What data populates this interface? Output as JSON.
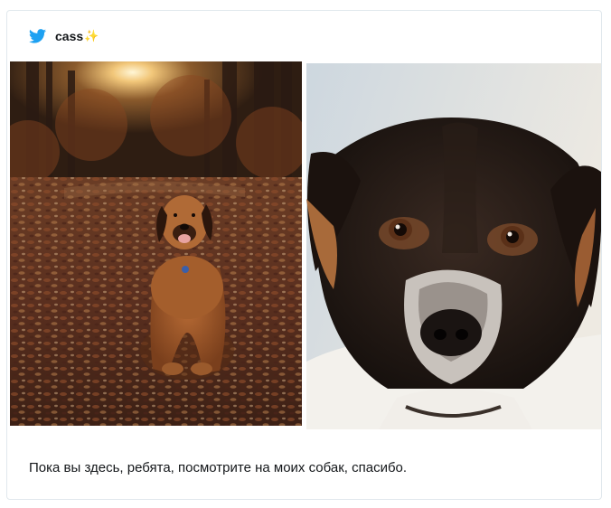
{
  "tweet": {
    "username": "cass",
    "username_emoji": "✨",
    "icon": "twitter-bird-icon",
    "text": "Пока вы здесь, ребята, посмотрите на моих собак, спасибо."
  },
  "colors": {
    "twitter_blue": "#1da1f2",
    "card_border": "#e1e8ed",
    "text": "#14171a"
  },
  "photos": [
    {
      "icon": "dog-in-autumn-forest-photo"
    },
    {
      "icon": "dog-face-closeup-photo"
    }
  ]
}
